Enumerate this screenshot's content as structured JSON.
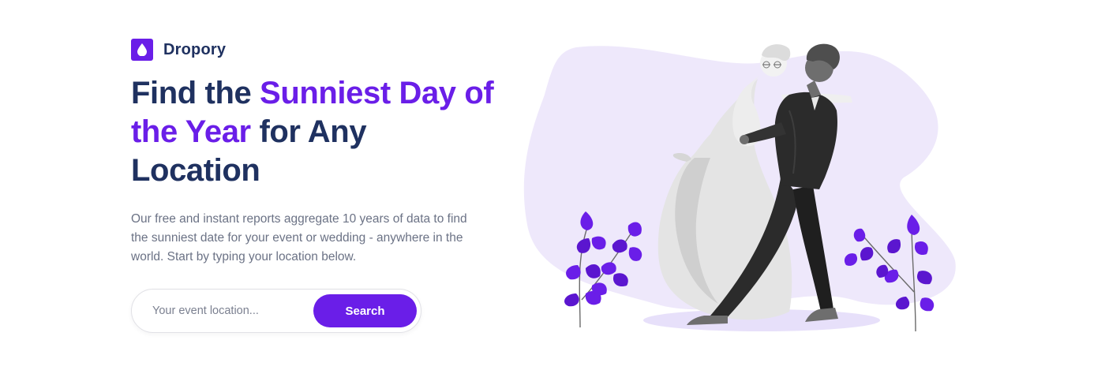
{
  "brand": {
    "name": "Dropory",
    "icon": "droplet-icon",
    "accent_color": "#6a1ee8",
    "text_color": "#1f3160"
  },
  "hero": {
    "headline_part1": "Find the ",
    "headline_accent": "Sunniest Day of the Year",
    "headline_part2": " for Any Location",
    "description": "Our free and instant reports aggregate 10 years of data to find the sunniest date for your event or wedding - anywhere in the world. Start by typing your location below."
  },
  "search": {
    "placeholder": "Your event location...",
    "value": "",
    "button_label": "Search"
  },
  "illustration": {
    "subject": "wedding-couple-dancing",
    "blob_color": "#eee8fb",
    "leaf_color": "#6a1ee8"
  }
}
